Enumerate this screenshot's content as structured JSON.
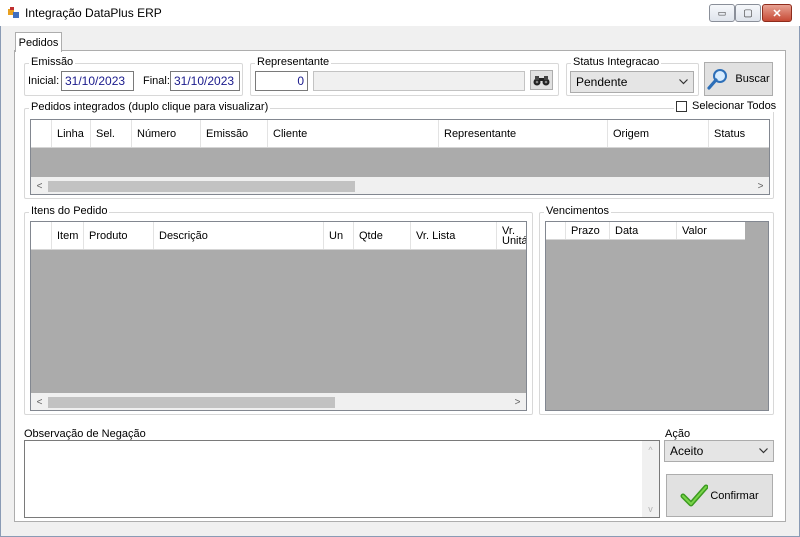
{
  "window": {
    "title": "Integração DataPlus ERP",
    "minimize_symbol": "▭",
    "maximize_symbol": "▢",
    "close_symbol": "✕"
  },
  "tabs": [
    {
      "label": "Pedidos"
    }
  ],
  "emissao": {
    "group_label": "Emissão",
    "inicial_label": "Inicial:",
    "inicial_value": "31/10/2023",
    "final_label": "Final:",
    "final_value": "31/10/2023"
  },
  "representante": {
    "group_label": "Representante",
    "code_value": "0",
    "name_value": ""
  },
  "status_integracao": {
    "group_label": "Status Integracao",
    "selected": "Pendente"
  },
  "buscar_label": "Buscar",
  "pedidos": {
    "group_label": "Pedidos integrados (duplo clique para visualizar)",
    "select_all_label": "Selecionar Todos",
    "columns": [
      "Linha",
      "Sel.",
      "Número",
      "Emissão",
      "Cliente",
      "Representante",
      "Origem",
      "Status"
    ]
  },
  "itens": {
    "group_label": "Itens do Pedido",
    "columns": [
      "Item",
      "Produto",
      "Descrição",
      "Un",
      "Qtde",
      "Vr. Lista",
      "Vr. Unitá"
    ]
  },
  "vencimentos": {
    "group_label": "Vencimentos",
    "columns": [
      "Prazo",
      "Data",
      "Valor"
    ]
  },
  "observacao": {
    "label": "Observação de Negação",
    "value": ""
  },
  "acao": {
    "label": "Ação",
    "selected": "Aceito"
  },
  "confirmar_label": "Confirmar",
  "colors": {
    "grid_background": "#ababab",
    "text_value": "#1a1a8c",
    "close_button": "#c64a35"
  }
}
